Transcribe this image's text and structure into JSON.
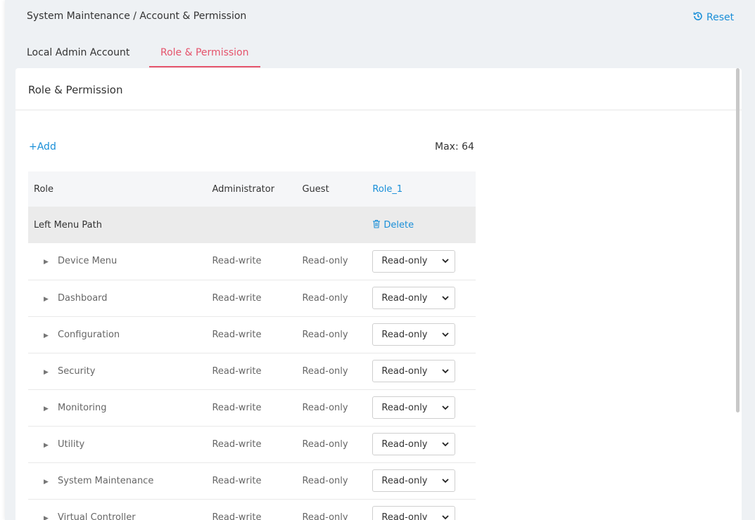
{
  "header": {
    "breadcrumb": "System Maintenance / Account & Permission",
    "reset_label": "Reset"
  },
  "tabs": [
    {
      "label": "Local Admin Account",
      "active": false
    },
    {
      "label": "Role & Permission",
      "active": true
    }
  ],
  "panel": {
    "title": "Role & Permission",
    "add_label": "+Add",
    "max_label": "Max: 64"
  },
  "table": {
    "headers": [
      "Role",
      "Administrator",
      "Guest",
      "Role_1"
    ],
    "subheader": {
      "label": "Left Menu Path",
      "delete_label": "Delete"
    },
    "rows": [
      {
        "name": "Device Menu",
        "admin": "Read-write",
        "guest": "Read-only",
        "role_1": "Read-only"
      },
      {
        "name": "Dashboard",
        "admin": "Read-write",
        "guest": "Read-only",
        "role_1": "Read-only"
      },
      {
        "name": "Configuration",
        "admin": "Read-write",
        "guest": "Read-only",
        "role_1": "Read-only"
      },
      {
        "name": "Security",
        "admin": "Read-write",
        "guest": "Read-only",
        "role_1": "Read-only"
      },
      {
        "name": "Monitoring",
        "admin": "Read-write",
        "guest": "Read-only",
        "role_1": "Read-only"
      },
      {
        "name": "Utility",
        "admin": "Read-write",
        "guest": "Read-only",
        "role_1": "Read-only"
      },
      {
        "name": "System Maintenance",
        "admin": "Read-write",
        "guest": "Read-only",
        "role_1": "Read-only"
      },
      {
        "name": "Virtual Controller",
        "admin": "Read-write",
        "guest": "Read-only",
        "role_1": "Read-only"
      }
    ]
  },
  "colors": {
    "accent": "#1a8fd8",
    "active_tab": "#e5536b"
  },
  "icons": {
    "reset": "history-icon",
    "delete": "trash-icon",
    "row_expand": "triangle-right-icon",
    "select_caret": "chevron-down-icon"
  }
}
